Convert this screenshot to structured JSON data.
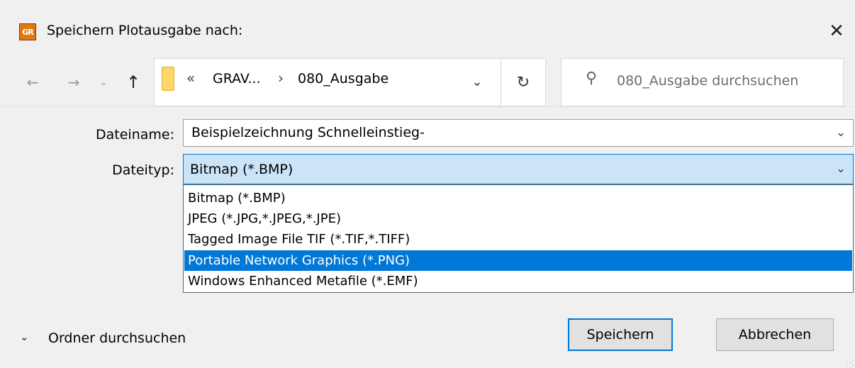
{
  "window": {
    "app_icon_text": "GR",
    "title": "Speichern Plotausgabe nach:",
    "close_glyph": "✕"
  },
  "nav": {
    "back_glyph": "←",
    "forward_glyph": "→",
    "recent_glyph": "⌄",
    "up_glyph": "↑",
    "breadcrumb_overflow": "«",
    "breadcrumb": [
      "GRAV...",
      "080_Ausgabe"
    ],
    "breadcrumb_separator": "›",
    "dropdown_glyph": "⌄",
    "refresh_glyph": "↻",
    "search_placeholder": "080_Ausgabe durchsuchen",
    "search_icon": "search-icon"
  },
  "form": {
    "filename_label": "Dateiname:",
    "filename_value": "Beispielzeichnung Schnelleinstieg-",
    "filetype_label": "Dateityp:",
    "filetype_selected": "Bitmap (*.BMP)",
    "filetype_options": [
      "Bitmap (*.BMP)",
      "JPEG (*.JPG,*.JPEG,*.JPE)",
      "Tagged Image File TIF (*.TIF,*.TIFF)",
      "Portable Network Graphics (*.PNG)",
      "Windows Enhanced Metafile (*.EMF)"
    ],
    "highlighted_option_index": 3,
    "dropdown_glyph": "⌄"
  },
  "footer": {
    "toggle_glyph": "⌄",
    "toggle_label": "Ordner durchsuchen",
    "save_label": "Speichern",
    "cancel_label": "Abbrechen"
  },
  "colors": {
    "accent": "#0078d7",
    "selected_field_bg": "#cce4f7",
    "dialog_bg": "#f0f0f0"
  }
}
